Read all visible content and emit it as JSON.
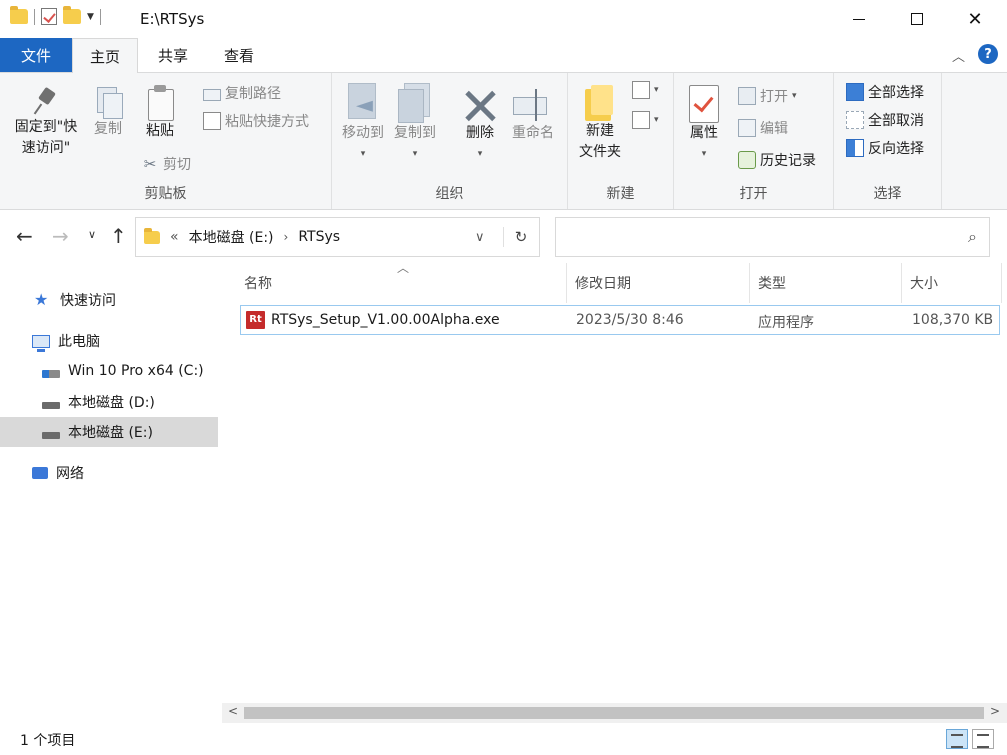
{
  "window": {
    "title": "E:\\RTSys",
    "controls": [
      "minimize-icon",
      "maximize-icon",
      "close-icon"
    ]
  },
  "ribbon_tabs": [
    {
      "label": "文件"
    },
    {
      "label": "主页"
    },
    {
      "label": "共享"
    },
    {
      "label": "查看"
    }
  ],
  "ribbon": {
    "clipboard": {
      "group_label": "剪贴板",
      "pin": "固定到\"快\n速访问\"",
      "copy": "复制",
      "paste": "粘贴",
      "copy_path": "复制路径",
      "paste_shortcut": "粘贴快捷方式",
      "cut": "剪切"
    },
    "organize": {
      "group_label": "组织",
      "move_to": "移动到",
      "copy_to": "复制到",
      "delete": "删除",
      "rename": "重命名"
    },
    "new": {
      "group_label": "新建",
      "new_folder": "新建\n文件夹"
    },
    "open": {
      "group_label": "打开",
      "properties": "属性",
      "open": "打开",
      "edit": "编辑",
      "history": "历史记录"
    },
    "select": {
      "group_label": "选择",
      "select_all": "全部选择",
      "select_none": "全部取消",
      "invert": "反向选择"
    }
  },
  "address": {
    "overflow": "«",
    "segments": [
      "本地磁盘 (E:)",
      "RTSys"
    ],
    "search_placeholder": ""
  },
  "nav_pane": {
    "items": [
      {
        "label": "快速访问",
        "icon": "star-icon"
      },
      {
        "label": "此电脑",
        "icon": "computer-icon"
      },
      {
        "label": "Win 10 Pro x64 (C:)",
        "icon": "system-drive-icon"
      },
      {
        "label": "本地磁盘 (D:)",
        "icon": "drive-icon"
      },
      {
        "label": "本地磁盘 (E:)",
        "icon": "drive-icon",
        "selected": true
      },
      {
        "label": "网络",
        "icon": "network-icon"
      }
    ]
  },
  "file_list": {
    "columns": [
      "名称",
      "修改日期",
      "类型",
      "大小"
    ],
    "rows": [
      {
        "name": "RTSys_Setup_V1.00.00Alpha.exe",
        "modified": "2023/5/30 8:46",
        "type": "应用程序",
        "size": "108,370 KB",
        "icon_text": "Rt"
      }
    ]
  },
  "status_bar": {
    "item_count": "1 个项目"
  },
  "colors": {
    "accent": "#1d67c2",
    "selection_border": "#99c9ef",
    "nav_selected": "#d9d9d9"
  }
}
